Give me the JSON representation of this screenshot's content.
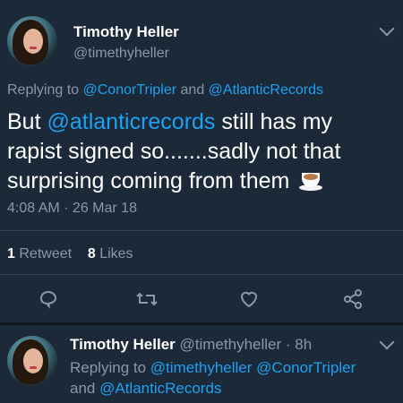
{
  "tweet": {
    "author_name": "Timothy Heller",
    "author_handle": "@timethyheller",
    "replying_prefix": "Replying to",
    "reply_to_1": "@ConorTripler",
    "reply_and": "and",
    "reply_to_2": "@AtlanticRecords",
    "text_part1": "But",
    "text_mention": "@atlanticrecords",
    "text_part2": "still has my rapist signed so.......sadly not that surprising coming from them",
    "timestamp": "4:08 AM · 26 Mar 18",
    "retweet_count": "1",
    "retweet_label": "Retweet",
    "likes_count": "8",
    "likes_label": "Likes"
  },
  "reply_tweet": {
    "author_name": "Timothy Heller",
    "author_handle": "@timethyheller",
    "time_ago": "· 8h",
    "replying_prefix": "Replying to",
    "reply_to_1": "@timethyheller",
    "reply_to_2": "@ConorTripler",
    "reply_and": "and",
    "reply_to_3": "@AtlanticRecords"
  },
  "icons": [
    "chevron-down-icon",
    "reply-icon",
    "retweet-icon",
    "like-icon",
    "share-icon",
    "coffee-emoji"
  ],
  "colors": {
    "background": "#1c2938",
    "link": "#1da1f2",
    "muted": "#8899a6",
    "text": "#ffffff",
    "divider": "#38444d"
  }
}
